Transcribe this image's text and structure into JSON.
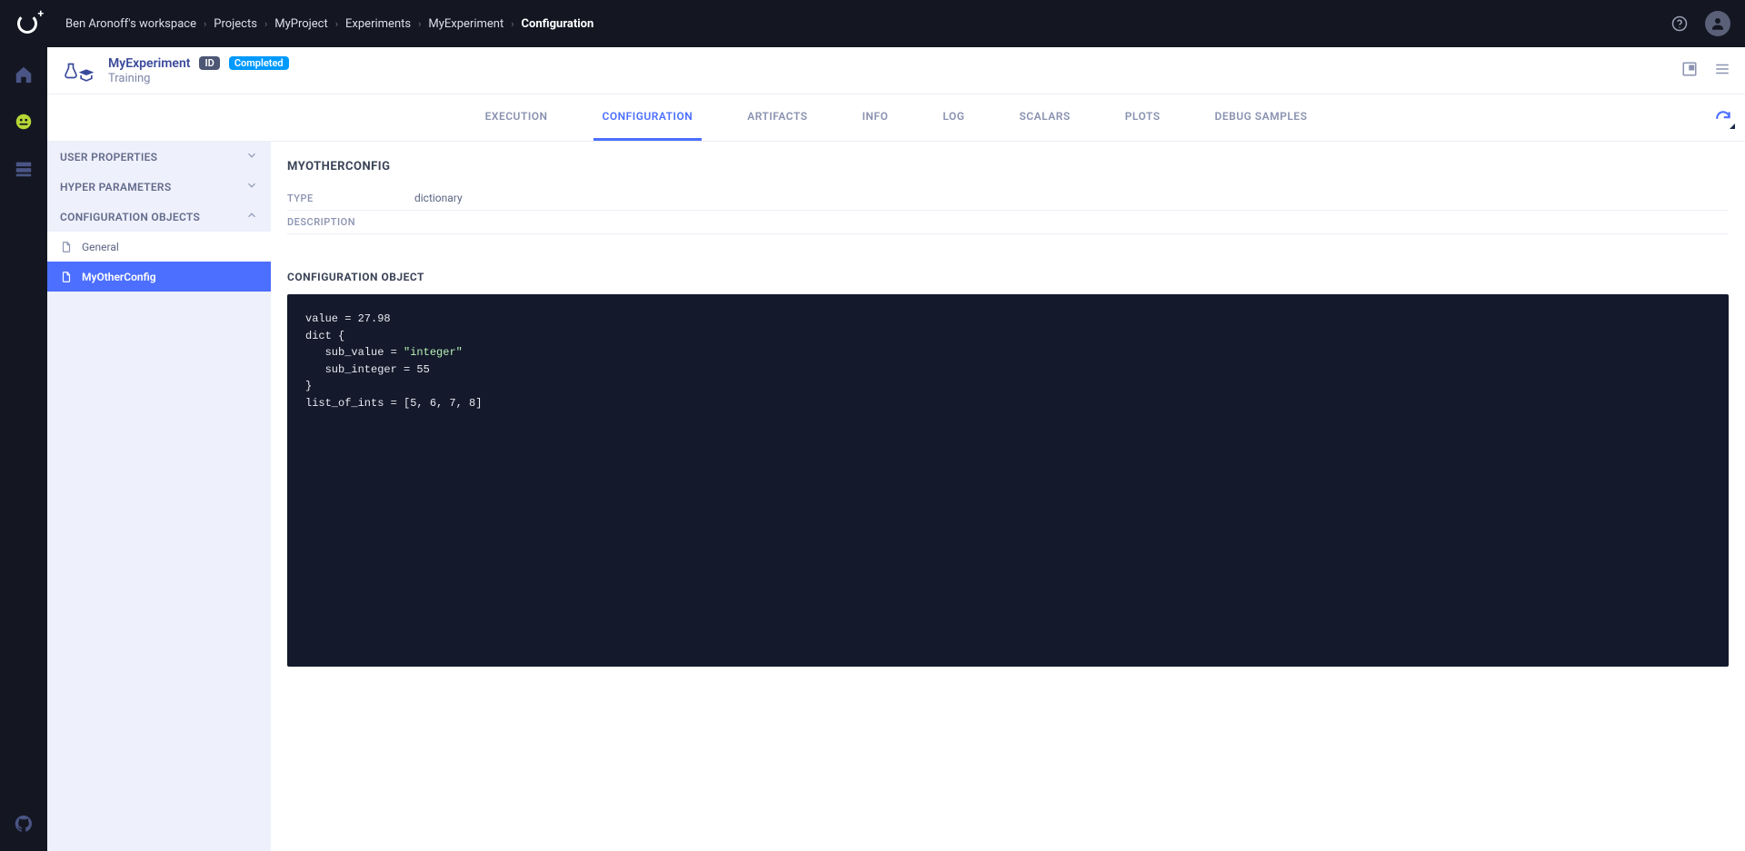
{
  "breadcrumbs": [
    "Ben Aronoff's workspace",
    "Projects",
    "MyProject",
    "Experiments",
    "MyExperiment",
    "Configuration"
  ],
  "page": {
    "title": "MyExperiment",
    "id_badge": "ID",
    "status_badge": "Completed",
    "subtitle": "Training"
  },
  "tabs": [
    "EXECUTION",
    "CONFIGURATION",
    "ARTIFACTS",
    "INFO",
    "LOG",
    "SCALARS",
    "PLOTS",
    "DEBUG SAMPLES"
  ],
  "active_tab_index": 1,
  "config_sidebar": {
    "groups": [
      {
        "label": "USER PROPERTIES",
        "expanded": false
      },
      {
        "label": "HYPER PARAMETERS",
        "expanded": false
      },
      {
        "label": "CONFIGURATION OBJECTS",
        "expanded": true,
        "items": [
          "General",
          "MyOtherConfig"
        ],
        "active_item_index": 1
      }
    ]
  },
  "detail": {
    "heading": "MYOTHERCONFIG",
    "type_label": "TYPE",
    "type_value": "dictionary",
    "description_label": "DESCRIPTION",
    "description_value": "",
    "object_section_title": "CONFIGURATION OBJECT",
    "code": "value = 27.98\ndict {\n   sub_value = \"integer\"\n   sub_integer = 55\n}\nlist_of_ints = [5, 6, 7, 8]"
  }
}
